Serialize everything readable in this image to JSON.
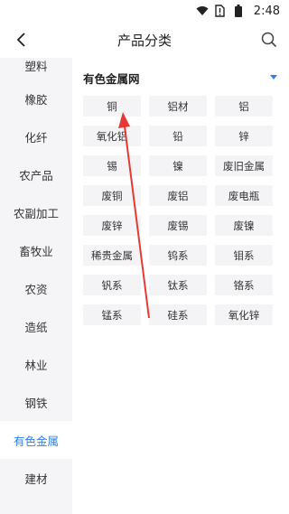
{
  "status": {
    "time": "2:48"
  },
  "header": {
    "title": "产品分类"
  },
  "sidebar": {
    "items": [
      {
        "label": "塑料"
      },
      {
        "label": "橡胶"
      },
      {
        "label": "化纤"
      },
      {
        "label": "农产品"
      },
      {
        "label": "农副加工"
      },
      {
        "label": "畜牧业"
      },
      {
        "label": "农资"
      },
      {
        "label": "造纸"
      },
      {
        "label": "林业"
      },
      {
        "label": "钢铁"
      },
      {
        "label": "有色金属"
      },
      {
        "label": "建材"
      }
    ],
    "active_label": "有色金属"
  },
  "main": {
    "section_title": "有色金属网",
    "chips": [
      {
        "label": "铜"
      },
      {
        "label": "铝材"
      },
      {
        "label": "铝"
      },
      {
        "label": "氧化铝"
      },
      {
        "label": "铅"
      },
      {
        "label": "锌"
      },
      {
        "label": "锡"
      },
      {
        "label": "镍"
      },
      {
        "label": "废旧金属"
      },
      {
        "label": "废铜"
      },
      {
        "label": "废铝"
      },
      {
        "label": "废电瓶"
      },
      {
        "label": "废锌"
      },
      {
        "label": "废锡"
      },
      {
        "label": "废镍"
      },
      {
        "label": "稀贵金属"
      },
      {
        "label": "钨系"
      },
      {
        "label": "钼系"
      },
      {
        "label": "钒系"
      },
      {
        "label": "钛系"
      },
      {
        "label": "铬系"
      },
      {
        "label": "锰系"
      },
      {
        "label": "硅系"
      },
      {
        "label": "氧化锌"
      }
    ]
  },
  "colors": {
    "accent": "#2f7fe3",
    "annotation_arrow": "#e53935"
  },
  "icons": {
    "back": "chevron-left-icon",
    "search": "search-icon",
    "caret": "caret-down-icon",
    "wifi": "wifi-icon",
    "battery": "battery-icon",
    "no_sim": "no-sim-icon"
  }
}
